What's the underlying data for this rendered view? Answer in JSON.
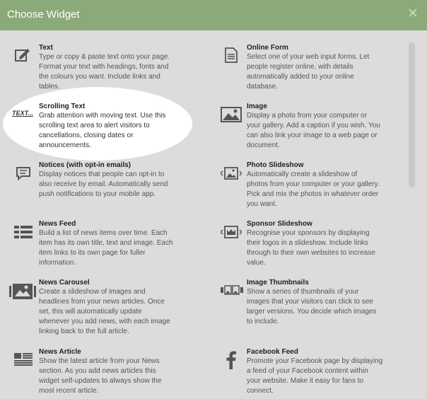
{
  "dialog": {
    "title": "Choose Widget",
    "close_label": "✕"
  },
  "widgets": [
    {
      "key": "text",
      "icon": "edit-icon",
      "title": "Text",
      "desc": [
        "Type or copy & paste text onto your page.",
        "Format your text with headings, fonts and",
        "the colours you want. Include links and",
        "tables."
      ]
    },
    {
      "key": "online-form",
      "icon": "form-icon",
      "title": "Online Form",
      "desc": [
        "Select one of your web input forms. Let",
        "people register online, with details",
        "automatically added to your online",
        "database."
      ]
    },
    {
      "key": "scrolling-text",
      "icon": "text-marquee-icon",
      "icon_text": "TEXT...",
      "title": "Scrolling Text",
      "desc": [
        "Grab attention with moving text. Use this",
        "scrolling text area to alert visitors to",
        "cancellations, closing dates or",
        "announcements."
      ]
    },
    {
      "key": "image",
      "icon": "image-icon",
      "title": "Image",
      "desc": [
        "Display a photo from your computer or",
        "your gallery. Add a caption if you wish. You",
        "can also link your image to a web page or",
        "document."
      ]
    },
    {
      "key": "notices",
      "icon": "speech-bubble-icon",
      "title": "Notices (with opt-in emails)",
      "desc": [
        "Display notices that people can opt-in to",
        "also receive by email. Automatically send",
        "push notifications to your mobile app."
      ]
    },
    {
      "key": "photo-slideshow",
      "icon": "slideshow-icon",
      "title": "Photo Slideshow",
      "desc": [
        "Automatically create a slideshow of",
        "photos from your computer or your gallery.",
        "Pick and mix the photos in whatever order",
        "you want."
      ]
    },
    {
      "key": "news-feed",
      "icon": "list-icon",
      "title": "News Feed",
      "desc": [
        "Build a list of news items over time. Each",
        "item has its own title, text and image. Each",
        "item links to its own page for fuller",
        "information."
      ]
    },
    {
      "key": "sponsor-slideshow",
      "icon": "crown-slideshow-icon",
      "title": "Sponsor Slideshow",
      "desc": [
        "Recognise your sponsors by displaying",
        "their logos in a slideshow. Include links",
        "through to their own websites to increase",
        "value."
      ]
    },
    {
      "key": "news-carousel",
      "icon": "carousel-icon",
      "title": "News Carousel",
      "desc": [
        "Create a slideshow of images and",
        "headlines from your news articles. Once",
        "set, this will automatically update",
        "whenever you add news, with each image",
        "linking back to the full article."
      ]
    },
    {
      "key": "image-thumbnails",
      "icon": "thumbnails-icon",
      "title": "Image Thumbnails",
      "desc": [
        "Show a series of thumbnails of your",
        "images that your visitors can click to see",
        "larger versions. You decide which images",
        "to include."
      ]
    },
    {
      "key": "news-article",
      "icon": "article-icon",
      "title": "News Article",
      "desc": [
        "Show the latest article from your News",
        "section. As you add news articles this",
        "widget self-updates to always show the",
        "most recent article."
      ]
    },
    {
      "key": "facebook-feed",
      "icon": "facebook-icon",
      "title": "Facebook Feed",
      "desc": [
        "Promote your Facebook page by displaying",
        "a feed of your Facebook content within",
        "your website. Make it easy for fans to",
        "connect."
      ]
    }
  ]
}
